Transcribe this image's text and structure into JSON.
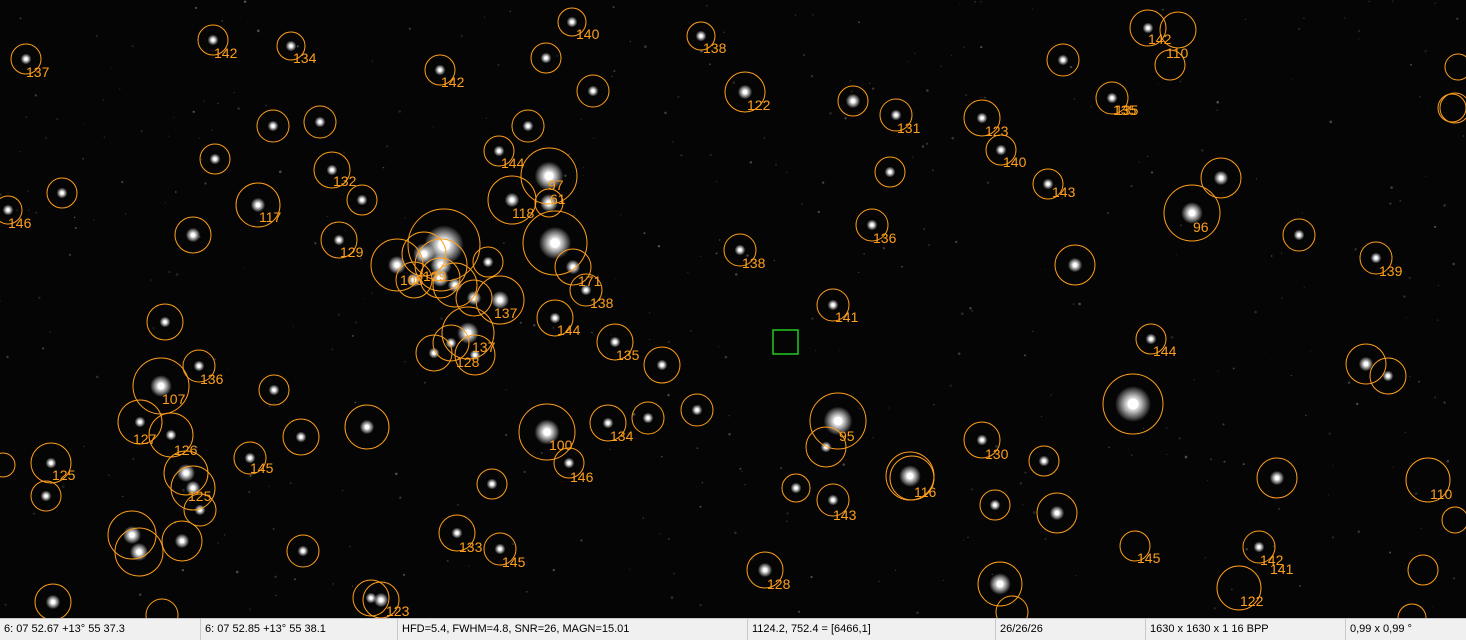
{
  "status": {
    "cursor_radec": "6: 07  52.67   +13° 55  37.3",
    "target_radec": "6: 07  52.85   +13° 55  38.1",
    "star_info": "HFD=5.4, FWHM=4.8, SNR=26, MAGN=15.01",
    "pixel_value": "1124.2, 752.4 = [6466,1]",
    "counts": "26/26/26",
    "image_size": "1630 x 1630 x 1   16 BPP",
    "scale": "0,99 x 0,99 °"
  },
  "colors": {
    "annotation": "#ff9f1c",
    "selection": "#22cc22",
    "star": "#ffffff"
  },
  "labels": [
    "137",
    "142",
    "134",
    "142",
    "140",
    "138",
    "122",
    "131",
    "123",
    "140",
    "135",
    "142",
    "110",
    "135",
    "132",
    "117",
    "146",
    "144",
    "97",
    "61",
    "118",
    "129",
    "171",
    "138",
    "136",
    "138",
    "141",
    "96",
    "139",
    "144",
    "108",
    "137",
    "128",
    "144",
    "135",
    "137",
    "129",
    "136",
    "107",
    "127",
    "126",
    "125",
    "125",
    "145",
    "100",
    "146",
    "134",
    "95",
    "143",
    "116",
    "130",
    "143",
    "133",
    "145",
    "128",
    "123",
    "145",
    "142",
    "141",
    "122",
    "110"
  ]
}
